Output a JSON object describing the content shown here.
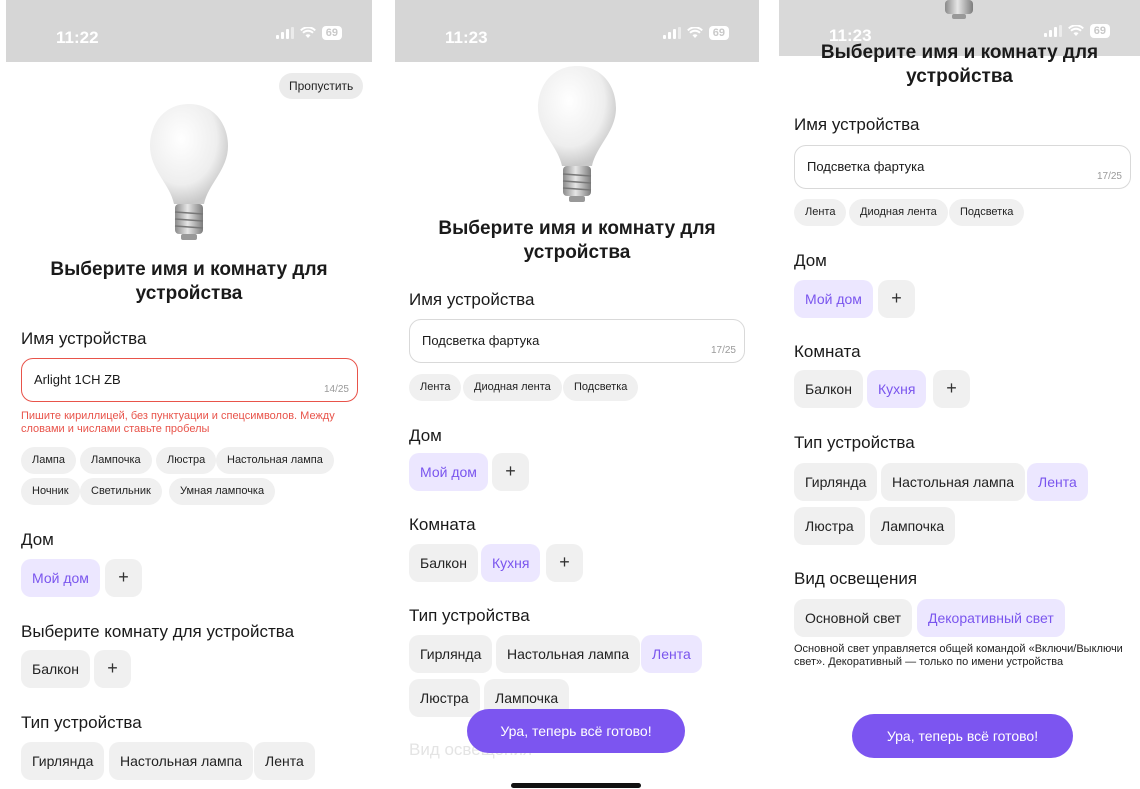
{
  "screens": [
    {
      "status_time": "11:22",
      "battery": "69",
      "skip_label": "Пропустить",
      "title_line1": "Выберите имя и комнату для",
      "title_line2": "устройства",
      "device_name_label": "Имя устройства",
      "name_value": "Arlight 1CH ZB",
      "name_counter": "14/25",
      "error_line1": "Пишите кириллицей, без пунктуации и спецсимволов. Между",
      "error_line2": "словами и числами ставьте пробелы",
      "suggestions": [
        "Лампа",
        "Лампочка",
        "Люстра",
        "Настольная лампа",
        "Ночник",
        "Светильник",
        "Умная лампочка"
      ],
      "home_label": "Дом",
      "home_selected": "Мой дом",
      "add": "+",
      "room_label": "Выберите комнату для устройства",
      "rooms": [
        "Балкон"
      ],
      "type_label": "Тип устройства",
      "types": [
        "Гирлянда",
        "Настольная лампа",
        "Лента"
      ]
    },
    {
      "status_time": "11:23",
      "battery": "69",
      "title_line1": "Выберите имя и комнату для",
      "title_line2": "устройства",
      "device_name_label": "Имя устройства",
      "name_value": "Подсветка фартука",
      "name_counter": "17/25",
      "suggestions": [
        "Лента",
        "Диодная лента",
        "Подсветка"
      ],
      "home_label": "Дом",
      "home_selected": "Мой дом",
      "add": "+",
      "room_label": "Комната",
      "rooms": [
        "Балкон",
        "Кухня"
      ],
      "type_label": "Тип устройства",
      "types": [
        "Гирлянда",
        "Настольная лампа",
        "Лента",
        "Люстра",
        "Лампочка"
      ],
      "hidden_label": "Вид освещения",
      "cta": "Ура, теперь всё готово!"
    },
    {
      "status_time": "11:23",
      "battery": "69",
      "title_line1": "Выберите имя и комнату для",
      "title_line2": "устройства",
      "device_name_label": "Имя устройства",
      "name_value": "Подсветка фартука",
      "name_counter": "17/25",
      "suggestions": [
        "Лента",
        "Диодная лента",
        "Подсветка"
      ],
      "home_label": "Дом",
      "home_selected": "Мой дом",
      "add": "+",
      "room_label": "Комната",
      "rooms": [
        "Балкон",
        "Кухня"
      ],
      "type_label": "Тип устройства",
      "types": [
        "Гирлянда",
        "Настольная лампа",
        "Лента",
        "Люстра",
        "Лампочка"
      ],
      "lighting_label": "Вид освещения",
      "lighting": [
        "Основной свет",
        "Декоративный свет"
      ],
      "lighting_note_line1": "Основной свет управляется общей командой «Включи/Выключи",
      "lighting_note_line2": "свет». Декоративный — только по имени устройства",
      "cta": "Ура, теперь всё готово!"
    }
  ],
  "colors": {
    "accent": "#7c55f0",
    "selected_bg": "#ece7ff",
    "selected_text": "#7a55ee",
    "error": "#e8534a",
    "chip_bg": "#f0f0f0",
    "status_bg": "#d6d6d6"
  },
  "icons": [
    "signal-icon",
    "wifi-icon",
    "battery-icon",
    "lightbulb-icon"
  ]
}
